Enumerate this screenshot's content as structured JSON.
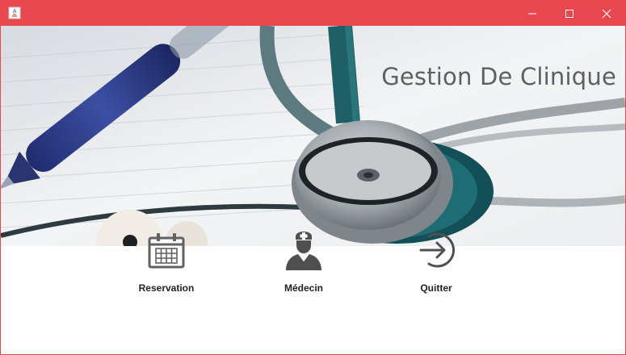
{
  "window": {
    "accent_color": "#e8474f",
    "controls": [
      "minimize-icon",
      "maximize-icon",
      "close-icon"
    ]
  },
  "hero": {
    "title": "Gestion De Clinique",
    "image": "stethoscope-and-pen-photo"
  },
  "menu": {
    "items": [
      {
        "label": "Reservation",
        "icon": "calendar-icon"
      },
      {
        "label": "Médecin",
        "icon": "doctor-icon"
      },
      {
        "label": "Quitter",
        "icon": "exit-icon"
      }
    ]
  }
}
